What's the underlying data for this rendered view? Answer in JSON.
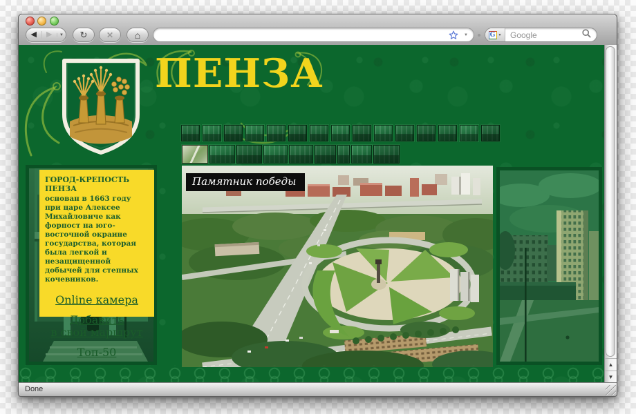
{
  "browser": {
    "toolbar": {
      "address_value": "",
      "search_placeholder": "Google"
    },
    "status": "Done"
  },
  "icons": {
    "back": "◀",
    "forward": "▶",
    "reload": "↻",
    "stop": "✕",
    "home": "⌂",
    "caret_down": "▼",
    "arrow_up": "▲",
    "arrow_down": "▼"
  },
  "page": {
    "title": "ПЕНЗА",
    "info_box": {
      "heading": "ГОРОД-КРЕПОСТЬ ПЕНЗА",
      "body": "основан в 1663 году при царе Алексее Михайловиче как форпост на юго-восточной окраине государства, которая была легкой и незащищенной добычей для степных кочевников.",
      "links": [
        {
          "label": "Online камера"
        },
        {
          "label": "Добавить\nв свой маршрут"
        },
        {
          "label": "Топ-50"
        }
      ]
    },
    "gallery": {
      "row1_count": 15,
      "row2_widths": [
        38,
        37,
        37,
        35,
        35,
        31,
        18,
        30,
        38
      ],
      "selected_index": 0
    },
    "main_photo": {
      "caption": "Памятник победы"
    }
  },
  "colors": {
    "page_green": "#0c672d",
    "pattern_light": "#2a8050",
    "title_yellow": "#f2d41d",
    "box_yellow": "#f8da29",
    "text_green": "#1b5e2d",
    "caption_bg": "#0d0d0d"
  }
}
